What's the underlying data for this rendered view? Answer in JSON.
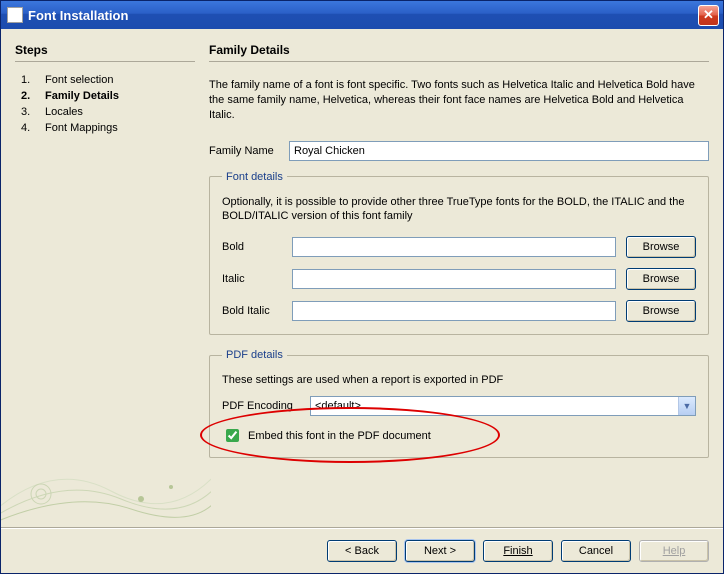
{
  "window": {
    "title": "Font Installation"
  },
  "steps": {
    "heading": "Steps",
    "items": [
      {
        "num": "1.",
        "label": "Font selection"
      },
      {
        "num": "2.",
        "label": "Family Details"
      },
      {
        "num": "3.",
        "label": "Locales"
      },
      {
        "num": "4.",
        "label": "Font Mappings"
      }
    ],
    "current_index": 1
  },
  "main": {
    "heading": "Family Details",
    "description": "The family name of a font is font specific. Two fonts such as Helvetica Italic and Helvetica Bold have the same family name, Helvetica, whereas their font face names are Helvetica Bold and Helvetica Italic.",
    "family_name_label": "Family Name",
    "family_name_value": "Royal Chicken",
    "font_details": {
      "legend": "Font details",
      "description": "Optionally, it is possible to provide other three TrueType fonts for the BOLD, the ITALIC and the BOLD/ITALIC version of this font family",
      "rows": [
        {
          "label": "Bold",
          "value": "",
          "browse": "Browse"
        },
        {
          "label": "Italic",
          "value": "",
          "browse": "Browse"
        },
        {
          "label": "Bold Italic",
          "value": "",
          "browse": "Browse"
        }
      ]
    },
    "pdf_details": {
      "legend": "PDF details",
      "description": "These settings are used when a report is exported in PDF",
      "encoding_label": "PDF Encoding",
      "encoding_value": "<default>",
      "embed_label": "Embed this font in the PDF document",
      "embed_checked": true
    }
  },
  "buttons": {
    "back": "< Back",
    "next": "Next >",
    "finish": "Finish",
    "cancel": "Cancel",
    "help": "Help"
  }
}
